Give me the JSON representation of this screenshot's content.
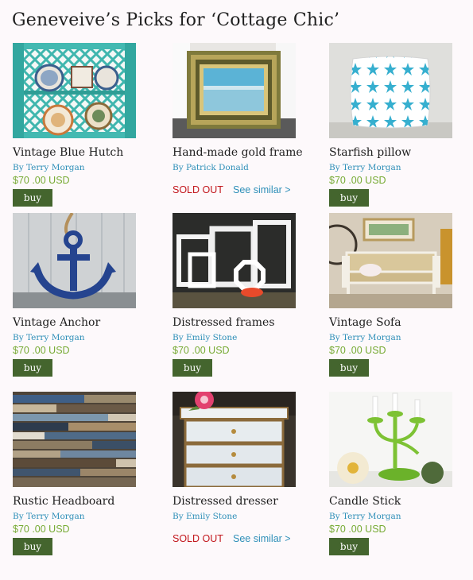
{
  "page": {
    "title": "Geneveive’s Picks for ‘Cottage Chic’"
  },
  "products": [
    {
      "title": "Vintage Blue Hutch",
      "seller": "By Terry Morgan",
      "price": "$70 .00 USD",
      "status": "available",
      "buy_label": "buy",
      "image": "blue-hutch-image"
    },
    {
      "title": "Hand-made gold frame",
      "seller": "By Patrick Donald",
      "status": "sold_out",
      "sold_label": "SOLD OUT",
      "similar_label": "See similar >",
      "image": "gold-frame-image"
    },
    {
      "title": "Starfish pillow",
      "seller": "By Terry Morgan",
      "price": "$70 .00 USD",
      "status": "available",
      "buy_label": "buy",
      "image": "starfish-pillow-image"
    },
    {
      "title": "Vintage Anchor",
      "seller": "By Terry Morgan",
      "price": "$70 .00 USD",
      "status": "available",
      "buy_label": "buy",
      "image": "anchor-image"
    },
    {
      "title": "Distressed frames",
      "seller": "By Emily Stone",
      "price": "$70 .00 USD",
      "status": "available",
      "buy_label": "buy",
      "image": "distressed-frames-image"
    },
    {
      "title": "Vintage Sofa",
      "seller": "By Terry Morgan",
      "price": "$70 .00 USD",
      "status": "available",
      "buy_label": "buy",
      "image": "sofa-image"
    },
    {
      "title": "Rustic Headboard",
      "seller": "By Terry Morgan",
      "price": "$70 .00 USD",
      "status": "available",
      "buy_label": "buy",
      "image": "headboard-image"
    },
    {
      "title": "Distressed dresser",
      "seller": "By Emily Stone",
      "status": "sold_out",
      "sold_label": "SOLD OUT",
      "similar_label": "See similar >",
      "image": "dresser-image"
    },
    {
      "title": "Candle Stick",
      "seller": "By Terry Morgan",
      "price": "$70 .00 USD",
      "status": "available",
      "buy_label": "buy",
      "image": "candlestick-image"
    }
  ],
  "colors": {
    "background": "#fdf9fb",
    "seller_link": "#2e8fb8",
    "price": "#76aa33",
    "buy_button": "#44652e",
    "sold_out": "#c2161c",
    "see_similar": "#2e8fb8"
  }
}
